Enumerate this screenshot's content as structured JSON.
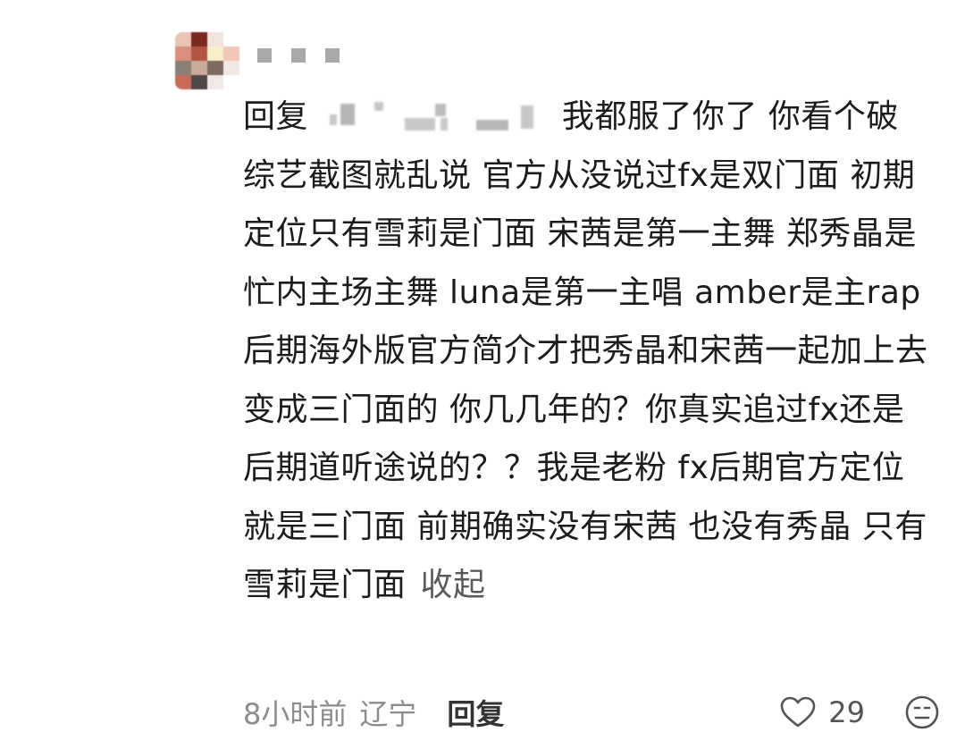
{
  "comment": {
    "reply_prefix": "回复",
    "body": "我都服了你了 你看个破综艺截图就乱说 官方从没说过fx是双门面 初期定位只有雪莉是门面 宋茜是第一主舞 郑秀晶是忙内主场主舞 luna是第一主唱 amber是主rap 后期海外版官方简介才把秀晶和宋茜一起加上去变成三门面的 你几几年的？你真实追过fx还是后期道听途说的？？我是老粉 fx后期官方定位就是三门面 前期确实没有宋茜 也没有秀晶 只有雪莉是门面",
    "collapse_label": "收起"
  },
  "meta": {
    "time": "8小时前",
    "location": "辽宁",
    "reply_label": "回复",
    "like_count": "29"
  },
  "icons": {
    "like": "heart-icon",
    "emoji": "emoji-icon"
  }
}
